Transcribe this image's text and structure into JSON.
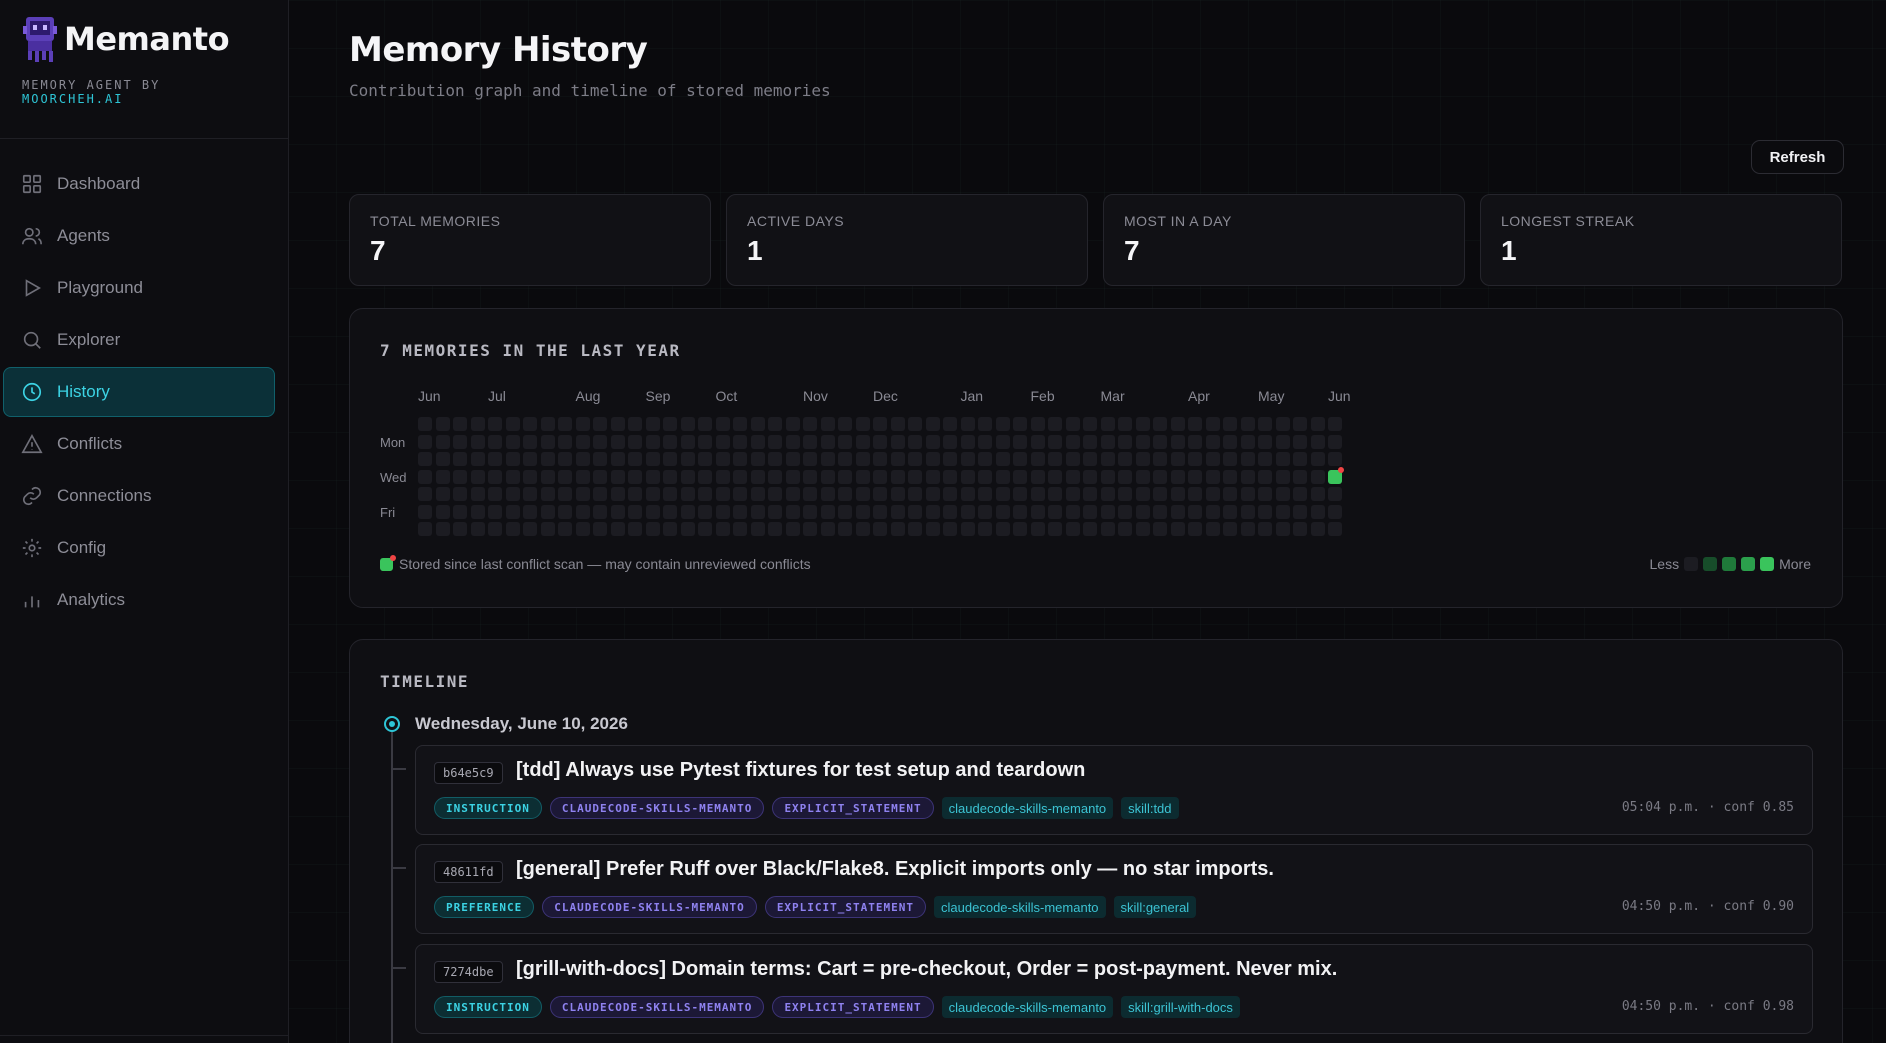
{
  "brand": {
    "name": "Memanto",
    "subtitle_prefix": "MEMORY AGENT BY",
    "subtitle_accent": "MOORCHEH.AI"
  },
  "nav": [
    {
      "label": "Dashboard",
      "icon": "grid-icon"
    },
    {
      "label": "Agents",
      "icon": "users-icon"
    },
    {
      "label": "Playground",
      "icon": "play-icon"
    },
    {
      "label": "Explorer",
      "icon": "search-icon"
    },
    {
      "label": "History",
      "icon": "clock-icon",
      "active": true
    },
    {
      "label": "Conflicts",
      "icon": "warning-icon"
    },
    {
      "label": "Connections",
      "icon": "link-icon"
    },
    {
      "label": "Config",
      "icon": "gear-icon"
    },
    {
      "label": "Analytics",
      "icon": "bar-chart-icon"
    }
  ],
  "header": {
    "title": "Memory History",
    "subtitle": "Contribution graph and timeline of stored memories",
    "refresh_label": "Refresh"
  },
  "stats": [
    {
      "label": "TOTAL MEMORIES",
      "value": "7"
    },
    {
      "label": "ACTIVE DAYS",
      "value": "1"
    },
    {
      "label": "MOST IN A DAY",
      "value": "7"
    },
    {
      "label": "LONGEST STREAK",
      "value": "1"
    }
  ],
  "heatmap": {
    "title": "7 MEMORIES IN THE LAST YEAR",
    "months": [
      "Jun",
      "Jul",
      "Aug",
      "Sep",
      "Oct",
      "Nov",
      "Dec",
      "Jan",
      "Feb",
      "Mar",
      "Apr",
      "May",
      "Jun"
    ],
    "day_labels": [
      "Mon",
      "Wed",
      "Fri"
    ],
    "weeks": 53,
    "active_cells": [
      {
        "week": 52,
        "day": 3,
        "level": 4,
        "flagged": true
      }
    ],
    "note": "Stored since last conflict scan — may contain unreviewed conflicts",
    "legend_less": "Less",
    "legend_more": "More",
    "legend_colors": [
      "#1c1c22",
      "#174d2a",
      "#1f7a3a",
      "#2ba04c",
      "#3ac45c"
    ]
  },
  "timeline": {
    "title": "TIMELINE",
    "date": "Wednesday, June 10, 2026",
    "entries": [
      {
        "id": "b64e5c9",
        "title": "[tdd] Always use Pytest fixtures for test setup and teardown",
        "type": "INSTRUCTION",
        "tags": [
          "CLAUDECODE-SKILLS-MEMANTO",
          "EXPLICIT_STATEMENT"
        ],
        "plain_tags": [
          "claudecode-skills-memanto",
          "skill:tdd"
        ],
        "meta": "05:04 p.m. · conf 0.85"
      },
      {
        "id": "48611fd",
        "title": "[general] Prefer Ruff over Black/Flake8. Explicit imports only — no star imports.",
        "type": "PREFERENCE",
        "tags": [
          "CLAUDECODE-SKILLS-MEMANTO",
          "EXPLICIT_STATEMENT"
        ],
        "plain_tags": [
          "claudecode-skills-memanto",
          "skill:general"
        ],
        "meta": "04:50 p.m. · conf 0.90"
      },
      {
        "id": "7274dbe",
        "title": "[grill-with-docs] Domain terms: Cart = pre-checkout, Order = post-payment. Never mix.",
        "type": "INSTRUCTION",
        "tags": [
          "CLAUDECODE-SKILLS-MEMANTO",
          "EXPLICIT_STATEMENT"
        ],
        "plain_tags": [
          "claudecode-skills-memanto",
          "skill:grill-with-docs"
        ],
        "meta": "04:50 p.m. · conf 0.98"
      }
    ]
  }
}
